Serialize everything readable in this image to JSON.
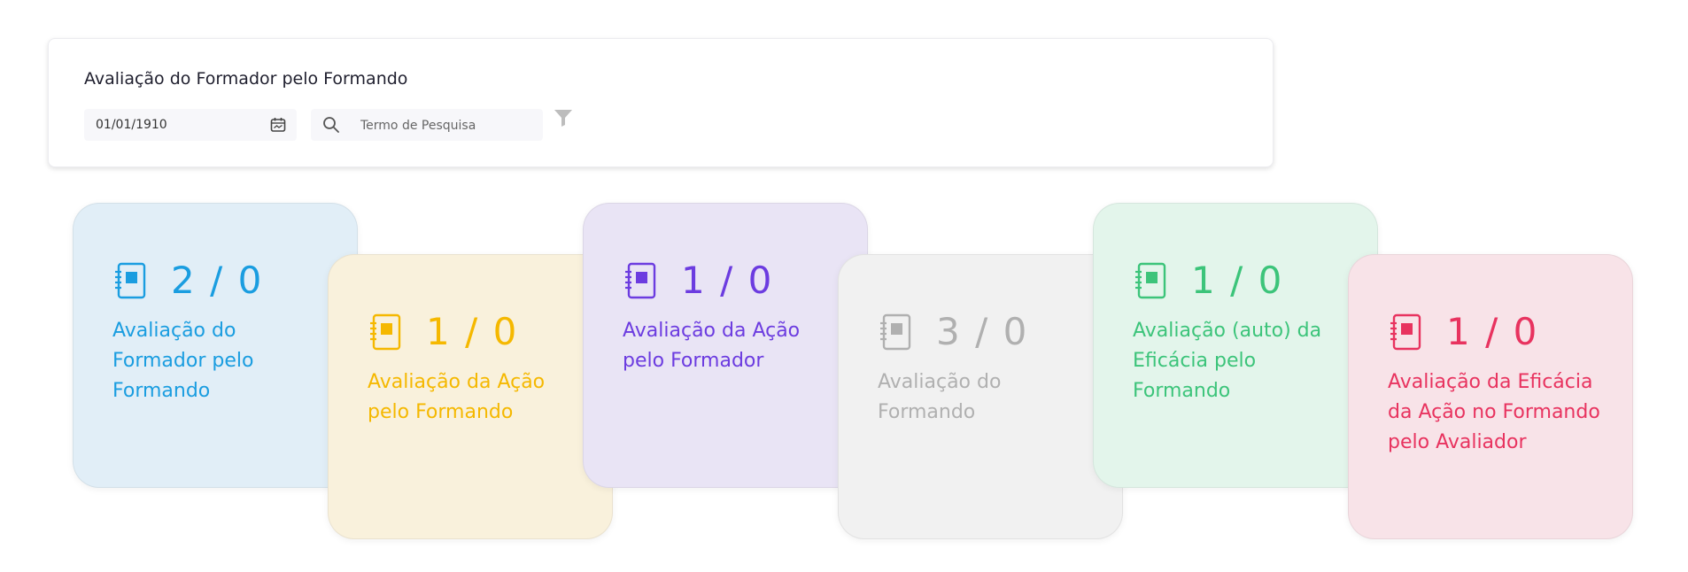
{
  "filter_panel": {
    "title": "Avaliação do Formador pelo Formando",
    "date_value": "01/01/1910",
    "search_placeholder": "Termo de Pesquisa"
  },
  "cards": [
    {
      "count": "2 / 0",
      "label": "Avaliação do Formador pelo Formando",
      "color": "#1a9de0",
      "bg": "#e1eef7"
    },
    {
      "count": "1 / 0",
      "label": "Avaliação da Ação pelo Formando",
      "color": "#f5b800",
      "bg": "#f9f1dc"
    },
    {
      "count": "1 / 0",
      "label": "Avaliação da Ação pelo Formador",
      "color": "#6c3ce0",
      "bg": "#e9e4f5"
    },
    {
      "count": "3 / 0",
      "label": "Avaliação do Formando",
      "color": "#b0b0b0",
      "bg": "#f1f1f1"
    },
    {
      "count": "1 / 0",
      "label": "Avaliação (auto) da Eficácia pelo Formando",
      "color": "#3cc47a",
      "bg": "#e3f5eb"
    },
    {
      "count": "1 / 0",
      "label": "Avaliação da Eficácia da Ação no Formando pelo Avaliador",
      "color": "#e8335f",
      "bg": "#f8e3e8"
    }
  ]
}
